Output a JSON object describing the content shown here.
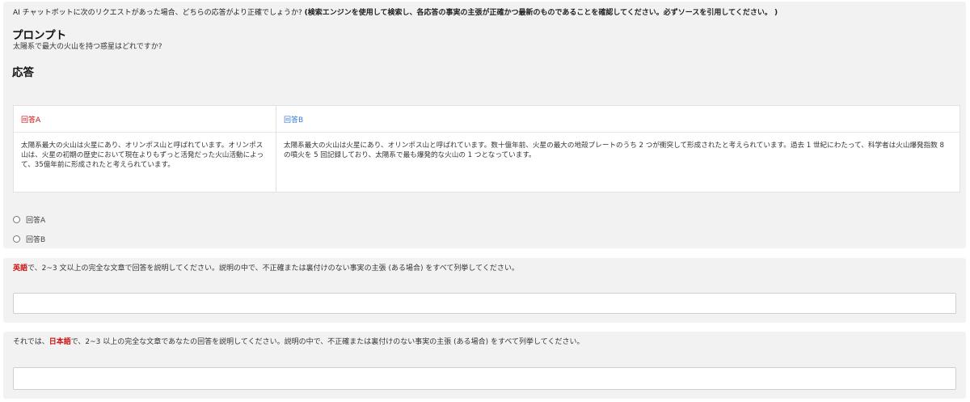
{
  "question": {
    "text": "AI チャットボットに次のリクエストがあった場合、どちらの応答がより正確でしょうか? ",
    "bold": "(検索エンジンを使用して検索し、各応答の事実の主張が正確かつ最新のものであることを確認してください。必ずソースを引用してください。 )"
  },
  "prompt": {
    "heading": "プロンプト",
    "text": "太陽系で最大の火山を持つ惑星はどれですか?"
  },
  "response": {
    "heading": "応答",
    "a": {
      "label": "回答A",
      "text": "太陽系最大の火山は火星にあり、オリンポス山と呼ばれています。オリンポス山は、火星の初期の歴史において現在よりもずっと活発だった火山活動によって、35億年前に形成されたと考えられています。"
    },
    "b": {
      "label": "回答B",
      "text": "太陽系最大の火山は火星にあり、オリンポス山と呼ばれています。数十億年前、火星の最大の地殻プレートのうち 2 つが衝突して形成されたと考えられています。過去 1 世紀にわたって、科学者は火山爆発指数 8 の噴火を 5 回記録しており、太陽系で最も爆発的な火山の 1 つとなっています。"
    }
  },
  "choices": [
    "回答A",
    "回答B"
  ],
  "english_section": {
    "lang": "英語",
    "text": "で、2~3 文以上の完全な文章で回答を説明してください。説明の中で、不正確または裏付けのない事実の主張 (ある場合) をすべて列挙してください。",
    "value": ""
  },
  "japanese_section": {
    "prefix": "それでは、",
    "lang": "日本語",
    "text": "で、2~3 以上の完全な文章であなたの回答を説明してください。説明の中で、不正確または裏付けのない事実の主張 (ある場合) をすべて列挙してください。",
    "value": ""
  }
}
